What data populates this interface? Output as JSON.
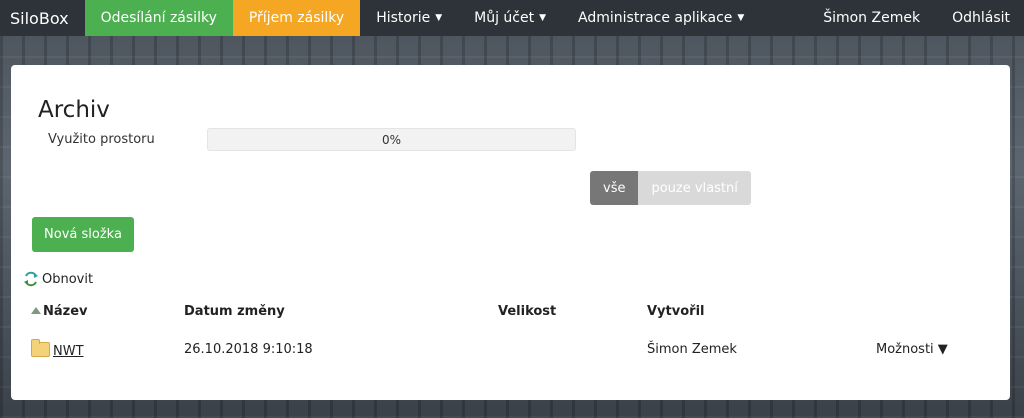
{
  "nav": {
    "brand": "SiloBox",
    "items": [
      {
        "label": "Odesílání zásilky",
        "dropdown": false
      },
      {
        "label": "Příjem zásilky",
        "dropdown": false
      },
      {
        "label": "Historie",
        "dropdown": true
      },
      {
        "label": "Můj účet",
        "dropdown": true
      },
      {
        "label": "Administrace aplikace",
        "dropdown": true
      }
    ],
    "user": "Šimon Zemek",
    "logout": "Odhlásit",
    "caret": "▼"
  },
  "archive": {
    "title": "Archiv",
    "usage_label": "Využito prostoru",
    "usage_percent_text": "0%",
    "usage_fraction": 0,
    "filter": {
      "all": "vše",
      "own": "pouze vlastní",
      "selected": "all"
    },
    "new_folder": "Nová složka",
    "refresh": "Obnovit"
  },
  "table": {
    "headers": {
      "name": "Název",
      "modified": "Datum změny",
      "size": "Velikost",
      "creator": "Vytvořil"
    },
    "rows": [
      {
        "name": "NWT",
        "modified": "26.10.2018 9:10:18",
        "size": "",
        "creator": "Šimon Zemek",
        "options": "Možnosti ▼"
      }
    ]
  },
  "colors": {
    "green": "#4caf50",
    "orange": "#f5a623",
    "navbar": "#2d3338"
  }
}
